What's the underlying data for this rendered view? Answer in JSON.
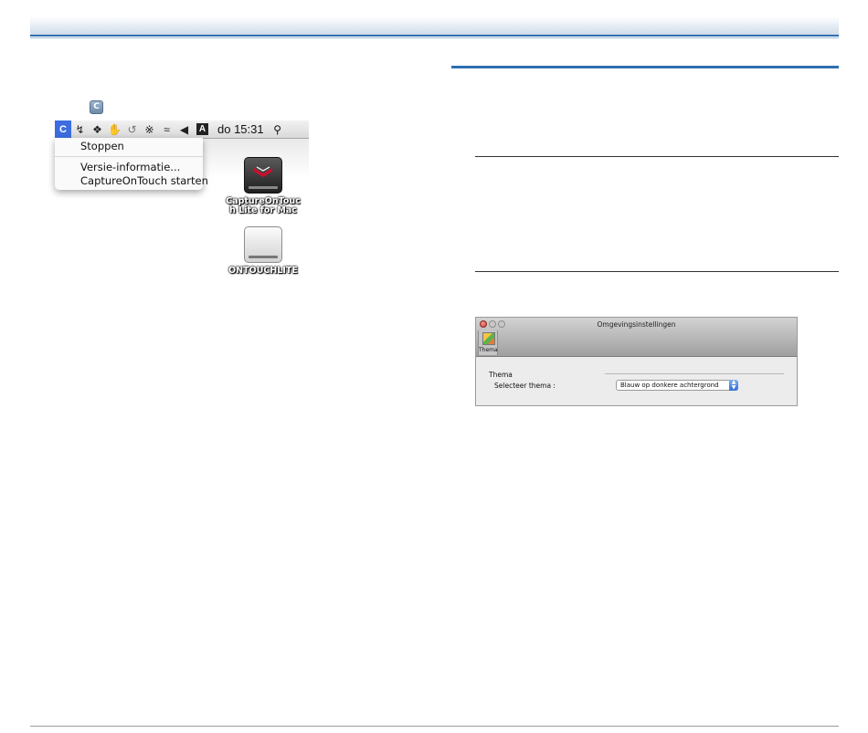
{
  "menubar": {
    "app_icon": "CaptureOnTouch-icon",
    "status_icons": [
      "eject-scanner-icon",
      "evernote-icon",
      "gesture-icon",
      "time-machine-icon",
      "bluetooth-icon",
      "wifi-icon",
      "volume-icon"
    ],
    "input_menu_letter": "A",
    "clock": "do 15:31",
    "search_icon": "spotlight-icon"
  },
  "menu": {
    "items": [
      "Stoppen",
      "Versie-informatie...",
      "CaptureOnTouch starten"
    ]
  },
  "desktop": {
    "disks": [
      {
        "label_line1": "CaptureOnTouc",
        "label_line2": "h Lite for Mac",
        "icon": "disk-image-icon"
      },
      {
        "label_line1": "ONTOUCHLITE",
        "label_line2": "",
        "icon": "removable-drive-icon"
      }
    ]
  },
  "prefs_window": {
    "title": "Omgevingsinstellingen",
    "toolbar_button": "Thema",
    "section": "Thema",
    "select_label": "Selecteer thema :",
    "select_value": "Blauw op donkere achtergrond"
  },
  "colors": {
    "accent": "#2e6fb0",
    "menu_highlight": "#3c6de0"
  }
}
